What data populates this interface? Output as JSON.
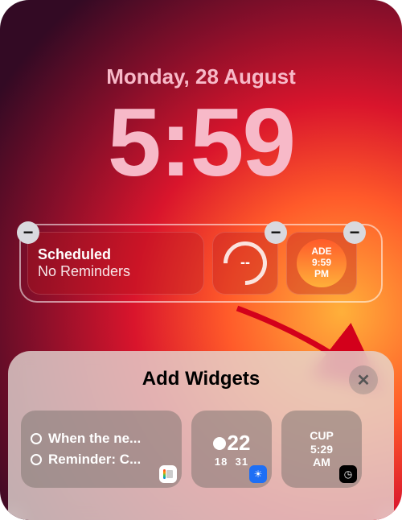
{
  "date": "Monday, 28 August",
  "time": "5:59",
  "widgets": {
    "scheduled": {
      "title": "Scheduled",
      "subtitle": "No Reminders"
    },
    "gauge": {
      "value": "--"
    },
    "world_clock": {
      "city": "ADE",
      "time": "9:59",
      "period": "PM"
    }
  },
  "sheet": {
    "title": "Add Widgets",
    "reminders": {
      "item1": "When the ne...",
      "item2": "Reminder: C..."
    },
    "weather": {
      "temp": "22",
      "low": "18",
      "high": "31"
    },
    "clock": {
      "city": "CUP",
      "time": "5:29",
      "period": "AM"
    }
  },
  "icons": {
    "minus": "−",
    "close": "✕",
    "sun": "☀",
    "clock": "◷",
    "list": "⋮⋮"
  }
}
